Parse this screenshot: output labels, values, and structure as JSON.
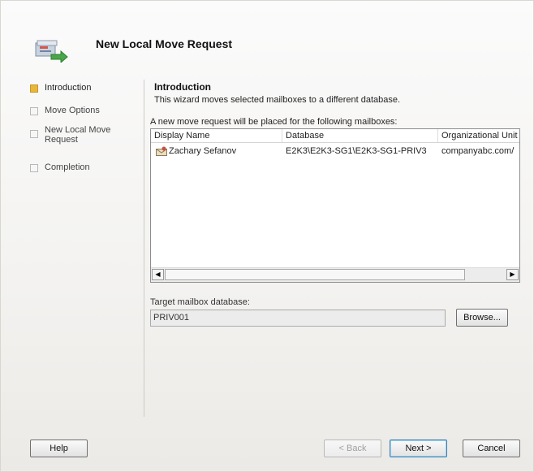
{
  "title": "New Local Move Request",
  "nav": {
    "items": [
      {
        "label": "Introduction",
        "active": true
      },
      {
        "label": "Move Options",
        "active": false
      },
      {
        "label": "New Local Move Request",
        "line1": "New Local Move",
        "line2": "Request",
        "active": false
      },
      {
        "label": "Completion",
        "active": false
      }
    ]
  },
  "content": {
    "section_title": "Introduction",
    "description": "This wizard moves selected mailboxes to a different database.",
    "list_caption": "A new move request will be placed for the following mailboxes:",
    "columns": [
      "Display Name",
      "Database",
      "Organizational Unit"
    ],
    "rows": [
      {
        "display_name": "Zachary Sefanov",
        "database": "E2K3\\E2K3-SG1\\E2K3-SG1-PRIV3",
        "ou": "companyabc.com/"
      }
    ],
    "target_label": "Target mailbox database:",
    "target_value": "PRIV001",
    "browse_label": "Browse..."
  },
  "buttons": {
    "help": "Help",
    "back": "< Back",
    "next": "Next >",
    "cancel": "Cancel"
  },
  "colors": {
    "active_step": "#e8b73a",
    "default_button_border": "#3c7fb1"
  },
  "icons": {
    "wizard": "mailbox-move-icon",
    "row": "mailbox-user-icon",
    "scroll_left": "scroll-left-icon",
    "scroll_right": "scroll-right-icon"
  }
}
